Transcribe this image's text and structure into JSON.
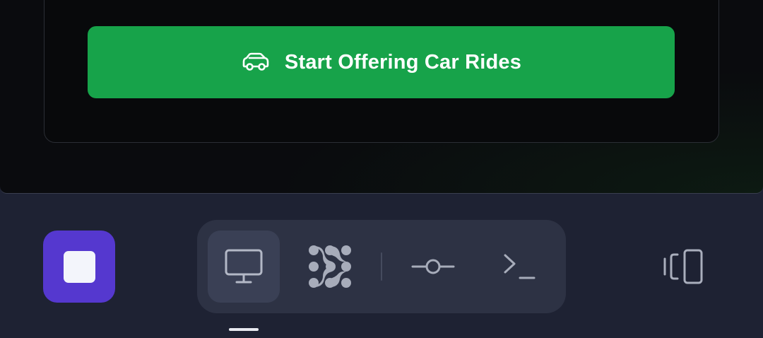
{
  "main": {
    "cta": {
      "label": "Start Offering Car Rides",
      "icon": "car-icon",
      "color": "#17a34a"
    }
  },
  "dock": {
    "stop_button": {
      "icon": "stop-icon",
      "color": "#5538cf"
    },
    "toolbar": {
      "tools": [
        {
          "id": "screen",
          "icon": "monitor-icon",
          "active": true
        },
        {
          "id": "network",
          "icon": "dots-network-icon",
          "active": false
        },
        {
          "id": "commit",
          "icon": "git-commit-icon",
          "active": false
        },
        {
          "id": "terminal",
          "icon": "terminal-icon",
          "active": false
        }
      ]
    },
    "side_button": {
      "icon": "device-switch-icon"
    }
  }
}
